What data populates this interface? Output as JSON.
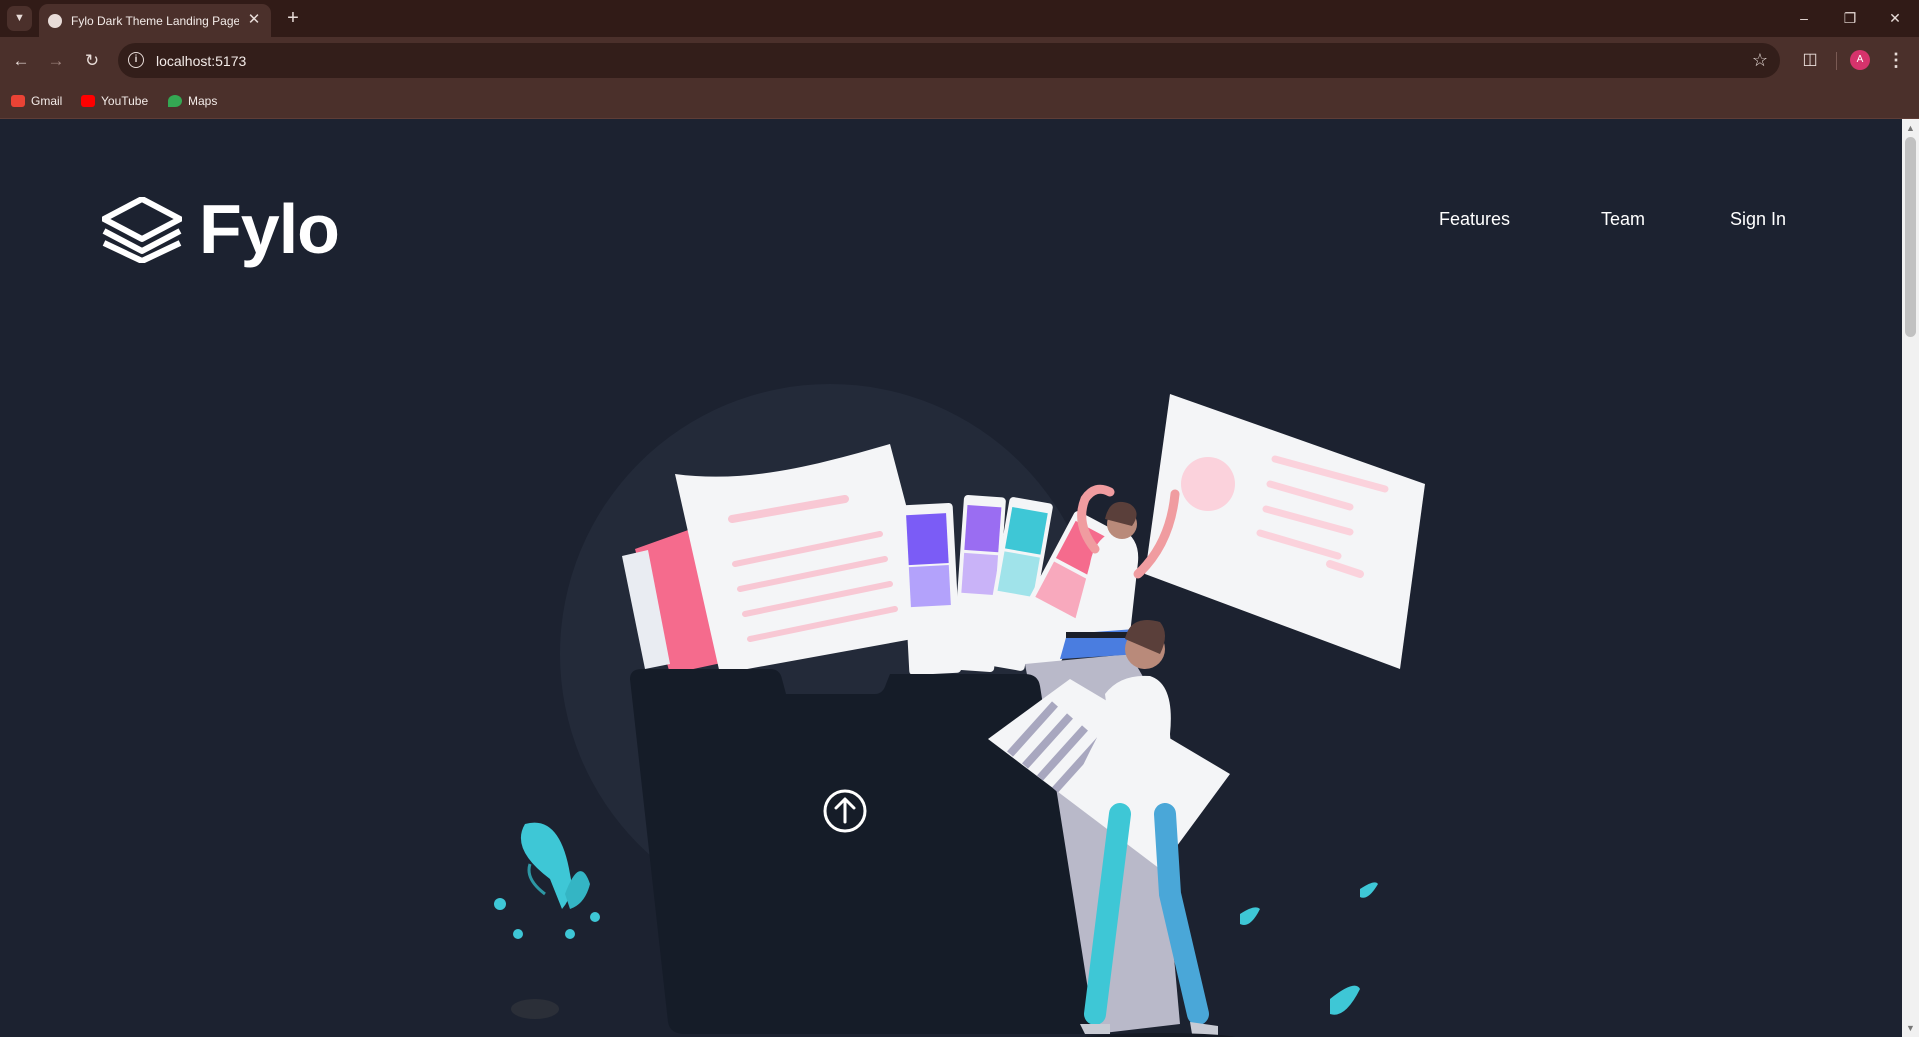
{
  "browser": {
    "tab_title": "Fylo Dark Theme Landing Page",
    "url": "localhost:5173",
    "avatar_initial": "A",
    "bookmarks": [
      {
        "label": "Gmail",
        "color": "#ea4335"
      },
      {
        "label": "YouTube",
        "color": "#ff0000"
      },
      {
        "label": "Maps",
        "color": "#34a853"
      }
    ]
  },
  "site": {
    "brand": "Fylo",
    "nav": [
      {
        "label": "Features"
      },
      {
        "label": "Team"
      },
      {
        "label": "Sign In"
      }
    ]
  },
  "colors": {
    "page_bg": "#1c2230",
    "accent_teal": "#3ec7d6",
    "accent_pink": "#f56b8d"
  },
  "icons": [
    "tab-list-icon",
    "close-icon",
    "plus-icon",
    "minimize-icon",
    "restore-icon",
    "back-icon",
    "forward-icon",
    "reload-icon",
    "info-icon",
    "star-icon",
    "extensions-icon",
    "kebab-menu-icon",
    "upload-arrow-icon"
  ]
}
